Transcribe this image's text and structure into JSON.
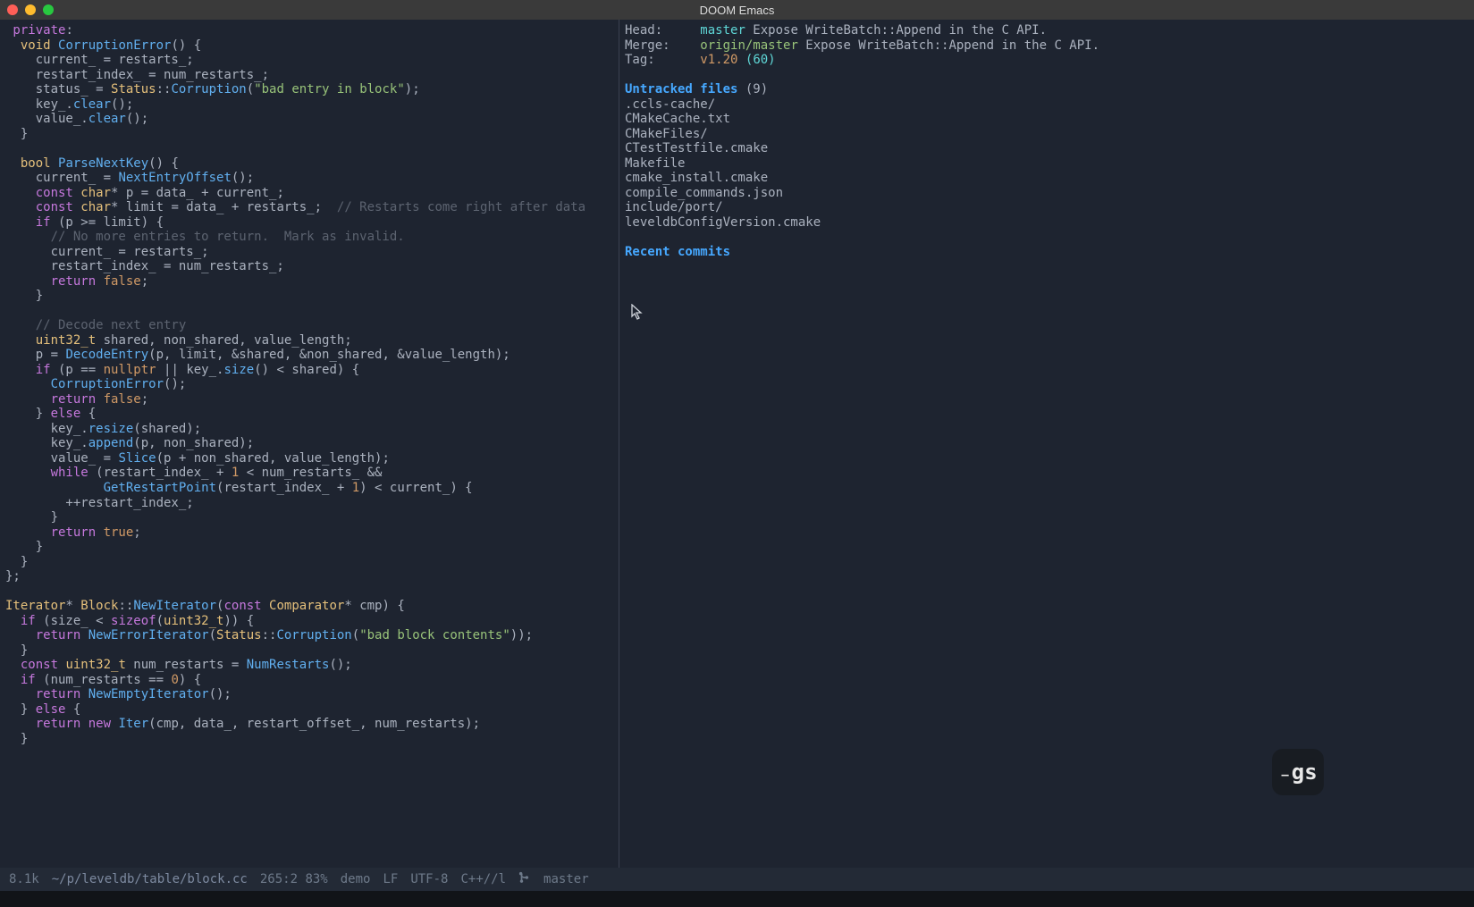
{
  "titlebar": {
    "title": "DOOM Emacs"
  },
  "left_code": {
    "lines": [
      [
        {
          "c": "kw",
          "t": " private"
        },
        {
          "c": "op",
          "t": ":"
        }
      ],
      [
        {
          "c": "ty",
          "t": "  void "
        },
        {
          "c": "fn",
          "t": "CorruptionError"
        },
        {
          "c": "op",
          "t": "() {"
        }
      ],
      [
        {
          "c": "op",
          "t": "    current_ = restarts_;"
        }
      ],
      [
        {
          "c": "op",
          "t": "    restart_index_ = num_restarts_;"
        }
      ],
      [
        {
          "c": "op",
          "t": "    status_ = "
        },
        {
          "c": "ty",
          "t": "Status"
        },
        {
          "c": "op",
          "t": "::"
        },
        {
          "c": "fn",
          "t": "Corruption"
        },
        {
          "c": "op",
          "t": "("
        },
        {
          "c": "str",
          "t": "\"bad entry in block\""
        },
        {
          "c": "op",
          "t": ");"
        }
      ],
      [
        {
          "c": "op",
          "t": "    key_."
        },
        {
          "c": "fn",
          "t": "clear"
        },
        {
          "c": "op",
          "t": "();"
        }
      ],
      [
        {
          "c": "op",
          "t": "    value_."
        },
        {
          "c": "fn",
          "t": "clear"
        },
        {
          "c": "op",
          "t": "();"
        }
      ],
      [
        {
          "c": "op",
          "t": "  }"
        }
      ],
      [
        {
          "c": "op",
          "t": ""
        }
      ],
      [
        {
          "c": "ty",
          "t": "  bool "
        },
        {
          "c": "fn",
          "t": "ParseNextKey"
        },
        {
          "c": "op",
          "t": "() {"
        }
      ],
      [
        {
          "c": "op",
          "t": "    current_ = "
        },
        {
          "c": "fn",
          "t": "NextEntryOffset"
        },
        {
          "c": "op",
          "t": "();"
        }
      ],
      [
        {
          "c": "kw",
          "t": "    const "
        },
        {
          "c": "ty",
          "t": "char"
        },
        {
          "c": "op",
          "t": "* p = data_ + current_;"
        }
      ],
      [
        {
          "c": "kw",
          "t": "    const "
        },
        {
          "c": "ty",
          "t": "char"
        },
        {
          "c": "op",
          "t": "* limit = data_ + restarts_;  "
        },
        {
          "c": "cm",
          "t": "// Restarts come right after data"
        }
      ],
      [
        {
          "c": "kw",
          "t": "    if"
        },
        {
          "c": "op",
          "t": " (p >= limit) {"
        }
      ],
      [
        {
          "c": "cm",
          "t": "      // No more entries to return.  Mark as invalid."
        }
      ],
      [
        {
          "c": "op",
          "t": "      current_ = restarts_;"
        }
      ],
      [
        {
          "c": "op",
          "t": "      restart_index_ = num_restarts_;"
        }
      ],
      [
        {
          "c": "kw",
          "t": "      return "
        },
        {
          "c": "num",
          "t": "false"
        },
        {
          "c": "op",
          "t": ";"
        }
      ],
      [
        {
          "c": "op",
          "t": "    }"
        }
      ],
      [
        {
          "c": "op",
          "t": ""
        }
      ],
      [
        {
          "c": "cm",
          "t": "    // Decode next entry"
        }
      ],
      [
        {
          "c": "ty",
          "t": "    uint32_t"
        },
        {
          "c": "op",
          "t": " shared, non_shared, value_length;"
        }
      ],
      [
        {
          "c": "op",
          "t": "    p = "
        },
        {
          "c": "fn",
          "t": "DecodeEntry"
        },
        {
          "c": "op",
          "t": "(p, limit, &shared, &non_shared, &value_length);"
        }
      ],
      [
        {
          "c": "kw",
          "t": "    if"
        },
        {
          "c": "op",
          "t": " (p == "
        },
        {
          "c": "num",
          "t": "nullptr"
        },
        {
          "c": "op",
          "t": " || key_."
        },
        {
          "c": "fn",
          "t": "size"
        },
        {
          "c": "op",
          "t": "() < shared) {"
        }
      ],
      [
        {
          "c": "fn",
          "t": "      CorruptionError"
        },
        {
          "c": "op",
          "t": "();"
        }
      ],
      [
        {
          "c": "kw",
          "t": "      return "
        },
        {
          "c": "num",
          "t": "false"
        },
        {
          "c": "op",
          "t": ";"
        }
      ],
      [
        {
          "c": "op",
          "t": "    } "
        },
        {
          "c": "kw",
          "t": "else"
        },
        {
          "c": "op",
          "t": " {"
        }
      ],
      [
        {
          "c": "op",
          "t": "      key_."
        },
        {
          "c": "fn",
          "t": "resize"
        },
        {
          "c": "op",
          "t": "(shared);"
        }
      ],
      [
        {
          "c": "op",
          "t": "      key_."
        },
        {
          "c": "fn",
          "t": "append"
        },
        {
          "c": "op",
          "t": "(p, non_shared);"
        }
      ],
      [
        {
          "c": "op",
          "t": "      value_ = "
        },
        {
          "c": "fn",
          "t": "Slice"
        },
        {
          "c": "op",
          "t": "(p + non_shared, value_length);"
        }
      ],
      [
        {
          "c": "kw",
          "t": "      while"
        },
        {
          "c": "op",
          "t": " (restart_index_ + "
        },
        {
          "c": "num",
          "t": "1"
        },
        {
          "c": "op",
          "t": " < num_restarts_ &&"
        }
      ],
      [
        {
          "c": "fn",
          "t": "             GetRestartPoint"
        },
        {
          "c": "op",
          "t": "(restart_index_ + "
        },
        {
          "c": "num",
          "t": "1"
        },
        {
          "c": "op",
          "t": ") < current_) {"
        }
      ],
      [
        {
          "c": "op",
          "t": "        ++restart_index_;"
        }
      ],
      [
        {
          "c": "op",
          "t": "      }"
        }
      ],
      [
        {
          "c": "kw",
          "t": "      return "
        },
        {
          "c": "num",
          "t": "true"
        },
        {
          "c": "op",
          "t": ";"
        }
      ],
      [
        {
          "c": "op",
          "t": "    }"
        }
      ],
      [
        {
          "c": "op",
          "t": "  }"
        }
      ],
      [
        {
          "c": "op",
          "t": "};"
        }
      ],
      [
        {
          "c": "op",
          "t": ""
        }
      ],
      [
        {
          "c": "ty",
          "t": "Iterator"
        },
        {
          "c": "op",
          "t": "* "
        },
        {
          "c": "ty",
          "t": "Block"
        },
        {
          "c": "op",
          "t": "::"
        },
        {
          "c": "fn",
          "t": "NewIterator"
        },
        {
          "c": "op",
          "t": "("
        },
        {
          "c": "kw",
          "t": "const "
        },
        {
          "c": "ty",
          "t": "Comparator"
        },
        {
          "c": "op",
          "t": "* cmp) {"
        }
      ],
      [
        {
          "c": "kw",
          "t": "  if"
        },
        {
          "c": "op",
          "t": " (size_ < "
        },
        {
          "c": "kw",
          "t": "sizeof"
        },
        {
          "c": "op",
          "t": "("
        },
        {
          "c": "ty",
          "t": "uint32_t"
        },
        {
          "c": "op",
          "t": ")) {"
        }
      ],
      [
        {
          "c": "kw",
          "t": "    return "
        },
        {
          "c": "fn",
          "t": "NewErrorIterator"
        },
        {
          "c": "op",
          "t": "("
        },
        {
          "c": "ty",
          "t": "Status"
        },
        {
          "c": "op",
          "t": "::"
        },
        {
          "c": "fn",
          "t": "Corruption"
        },
        {
          "c": "op",
          "t": "("
        },
        {
          "c": "str",
          "t": "\"bad block contents\""
        },
        {
          "c": "op",
          "t": "));"
        }
      ],
      [
        {
          "c": "op",
          "t": "  }"
        }
      ],
      [
        {
          "c": "kw",
          "t": "  const "
        },
        {
          "c": "ty",
          "t": "uint32_t"
        },
        {
          "c": "op",
          "t": " num_restarts = "
        },
        {
          "c": "fn",
          "t": "NumRestarts"
        },
        {
          "c": "op",
          "t": "();"
        }
      ],
      [
        {
          "c": "kw",
          "t": "  if"
        },
        {
          "c": "op",
          "t": " (num_restarts == "
        },
        {
          "c": "num",
          "t": "0"
        },
        {
          "c": "op",
          "t": ") {"
        }
      ],
      [
        {
          "c": "kw",
          "t": "    return "
        },
        {
          "c": "fn",
          "t": "NewEmptyIterator"
        },
        {
          "c": "op",
          "t": "();"
        }
      ],
      [
        {
          "c": "op",
          "t": "  } "
        },
        {
          "c": "kw",
          "t": "else"
        },
        {
          "c": "op",
          "t": " {"
        }
      ],
      [
        {
          "c": "kw",
          "t": "    return new "
        },
        {
          "c": "fn",
          "t": "Iter"
        },
        {
          "c": "op",
          "t": "(cmp, data_, restart_offset_, num_restarts);"
        }
      ],
      [
        {
          "c": "op",
          "t": "  }"
        }
      ]
    ]
  },
  "right_pane": {
    "head_label": "Head:",
    "head_branch": "master",
    "head_msg": "Expose WriteBatch::Append in the C API.",
    "merge_label": "Merge:",
    "merge_branch": "origin/master",
    "merge_msg": "Expose WriteBatch::Append in the C API.",
    "tag_label": "Tag:",
    "tag_name": "v1.20",
    "tag_dist": "(60)",
    "untracked_header": "Untracked files",
    "untracked_count": "(9)",
    "untracked": [
      ".ccls-cache/",
      "CMakeCache.txt",
      "CMakeFiles/",
      "CTestTestfile.cmake",
      "Makefile",
      "cmake_install.cmake",
      "compile_commands.json",
      "include/port/",
      "leveldbConfigVersion.cmake"
    ],
    "recent_header": "Recent commits"
  },
  "modeline": {
    "size": "8.1k",
    "path": "~/p/leveldb/table/block.cc",
    "pos": "265:2 83%",
    "mode_tag": "demo",
    "eol": "LF",
    "enc": "UTF-8",
    "major": "C++//l",
    "vcs": "master"
  },
  "badge": {
    "text": "₋gs"
  }
}
